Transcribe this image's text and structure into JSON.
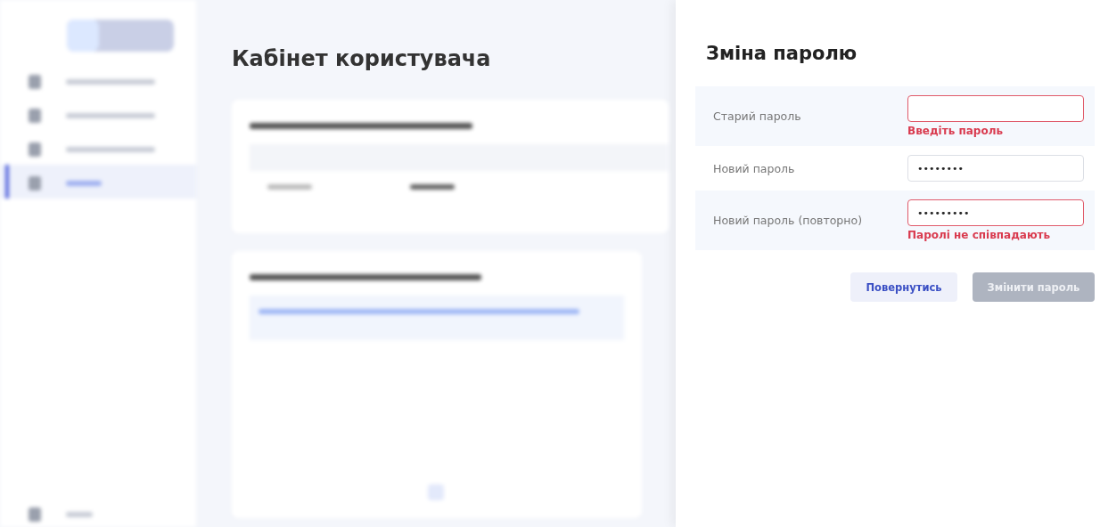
{
  "background_page": {
    "title": "Кабінет користувача"
  },
  "dialog": {
    "title": "Зміна паролю",
    "fields": [
      {
        "label": "Старий пароль",
        "error": true,
        "message": "Введіть пароль"
      },
      {
        "label": "Новий пароль",
        "value": "••••••••",
        "error": false
      },
      {
        "label": "Новий пароль (повторно)",
        "value": "•••••••••",
        "error": true,
        "message": "Паролі не співпадають"
      }
    ],
    "buttons": [
      {
        "label": "Повернутись",
        "kind": "secondary",
        "disabled": false
      },
      {
        "label": "Змінити пароль",
        "kind": "primary",
        "disabled": true
      }
    ]
  }
}
